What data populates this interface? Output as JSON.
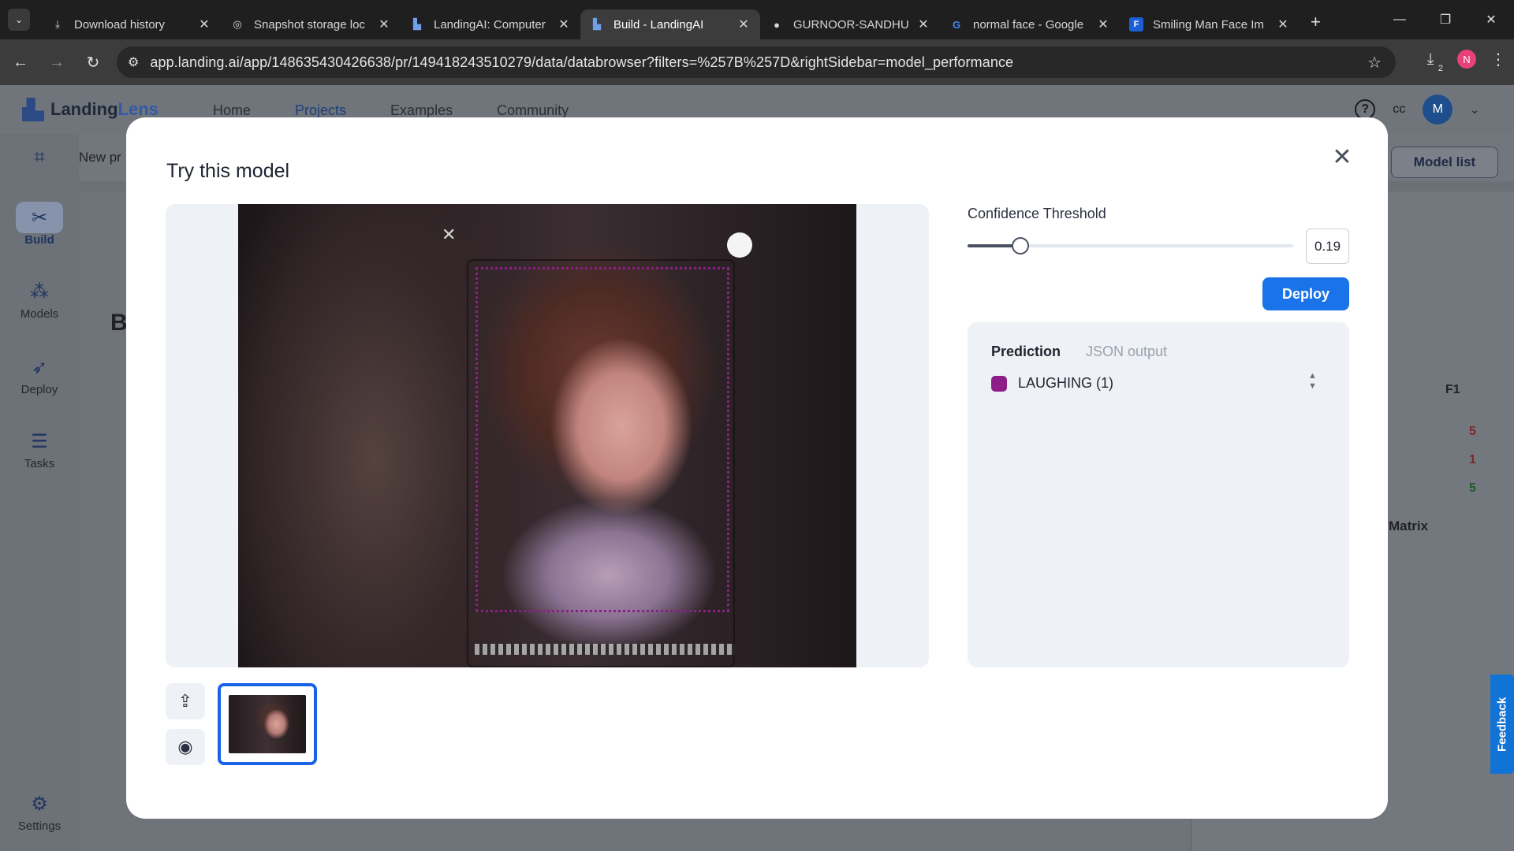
{
  "browser": {
    "tabs": [
      {
        "title": "Download history",
        "icon": "download-icon",
        "active": false
      },
      {
        "title": "Snapshot storage loc",
        "icon": "globe-icon",
        "active": false
      },
      {
        "title": "LandingAI: Computer",
        "icon": "landingai-icon",
        "active": false
      },
      {
        "title": "Build - LandingAI",
        "icon": "landingai-icon",
        "active": true
      },
      {
        "title": "GURNOOR-SANDHU",
        "icon": "github-icon",
        "active": false
      },
      {
        "title": "normal face - Google",
        "icon": "google-icon",
        "active": false
      },
      {
        "title": "Smiling Man Face Im",
        "icon": "freepik-icon",
        "active": false
      }
    ],
    "url": "app.landing.ai/app/148635430426638/pr/149418243510279/data/databrowser?filters=%257B%257D&rightSidebar=model_performance",
    "download_badge": "2",
    "profile_initial": "N"
  },
  "app": {
    "logo_part1": "Landing",
    "logo_part2": "Lens",
    "nav": [
      "Home",
      "Projects",
      "Examples",
      "Community"
    ],
    "active_nav": "Projects",
    "user_label": "cc",
    "user_initial": "M",
    "project_name": "New pr",
    "model_list_label": "Model list",
    "sidebar": [
      {
        "label": "Build",
        "icon": "build-tools-icon",
        "selected": true
      },
      {
        "label": "Models",
        "icon": "models-network-icon",
        "selected": false
      },
      {
        "label": "Deploy",
        "icon": "rocket-icon",
        "selected": false
      },
      {
        "label": "Tasks",
        "icon": "tasks-list-icon",
        "selected": false
      },
      {
        "label": "Settings",
        "icon": "gear-icon",
        "selected": false
      }
    ],
    "page_heading_fragment": "B",
    "right_panel": {
      "f1_label": "F1",
      "values": [
        "5",
        "1",
        "5"
      ],
      "matrix_label": "Matrix"
    },
    "feedback_label": "Feedback"
  },
  "modal": {
    "title": "Try this model",
    "confidence_label": "Confidence Threshold",
    "confidence_value": "0.19",
    "slider_fraction": 0.19,
    "deploy_label": "Deploy",
    "tabs": {
      "prediction": "Prediction",
      "json": "JSON output"
    },
    "predictions": [
      {
        "label": "LAUGHING (1)",
        "color": "#8e1e87"
      }
    ]
  },
  "colors": {
    "accent": "#1a73e8",
    "bbox": "#8e1e87"
  }
}
